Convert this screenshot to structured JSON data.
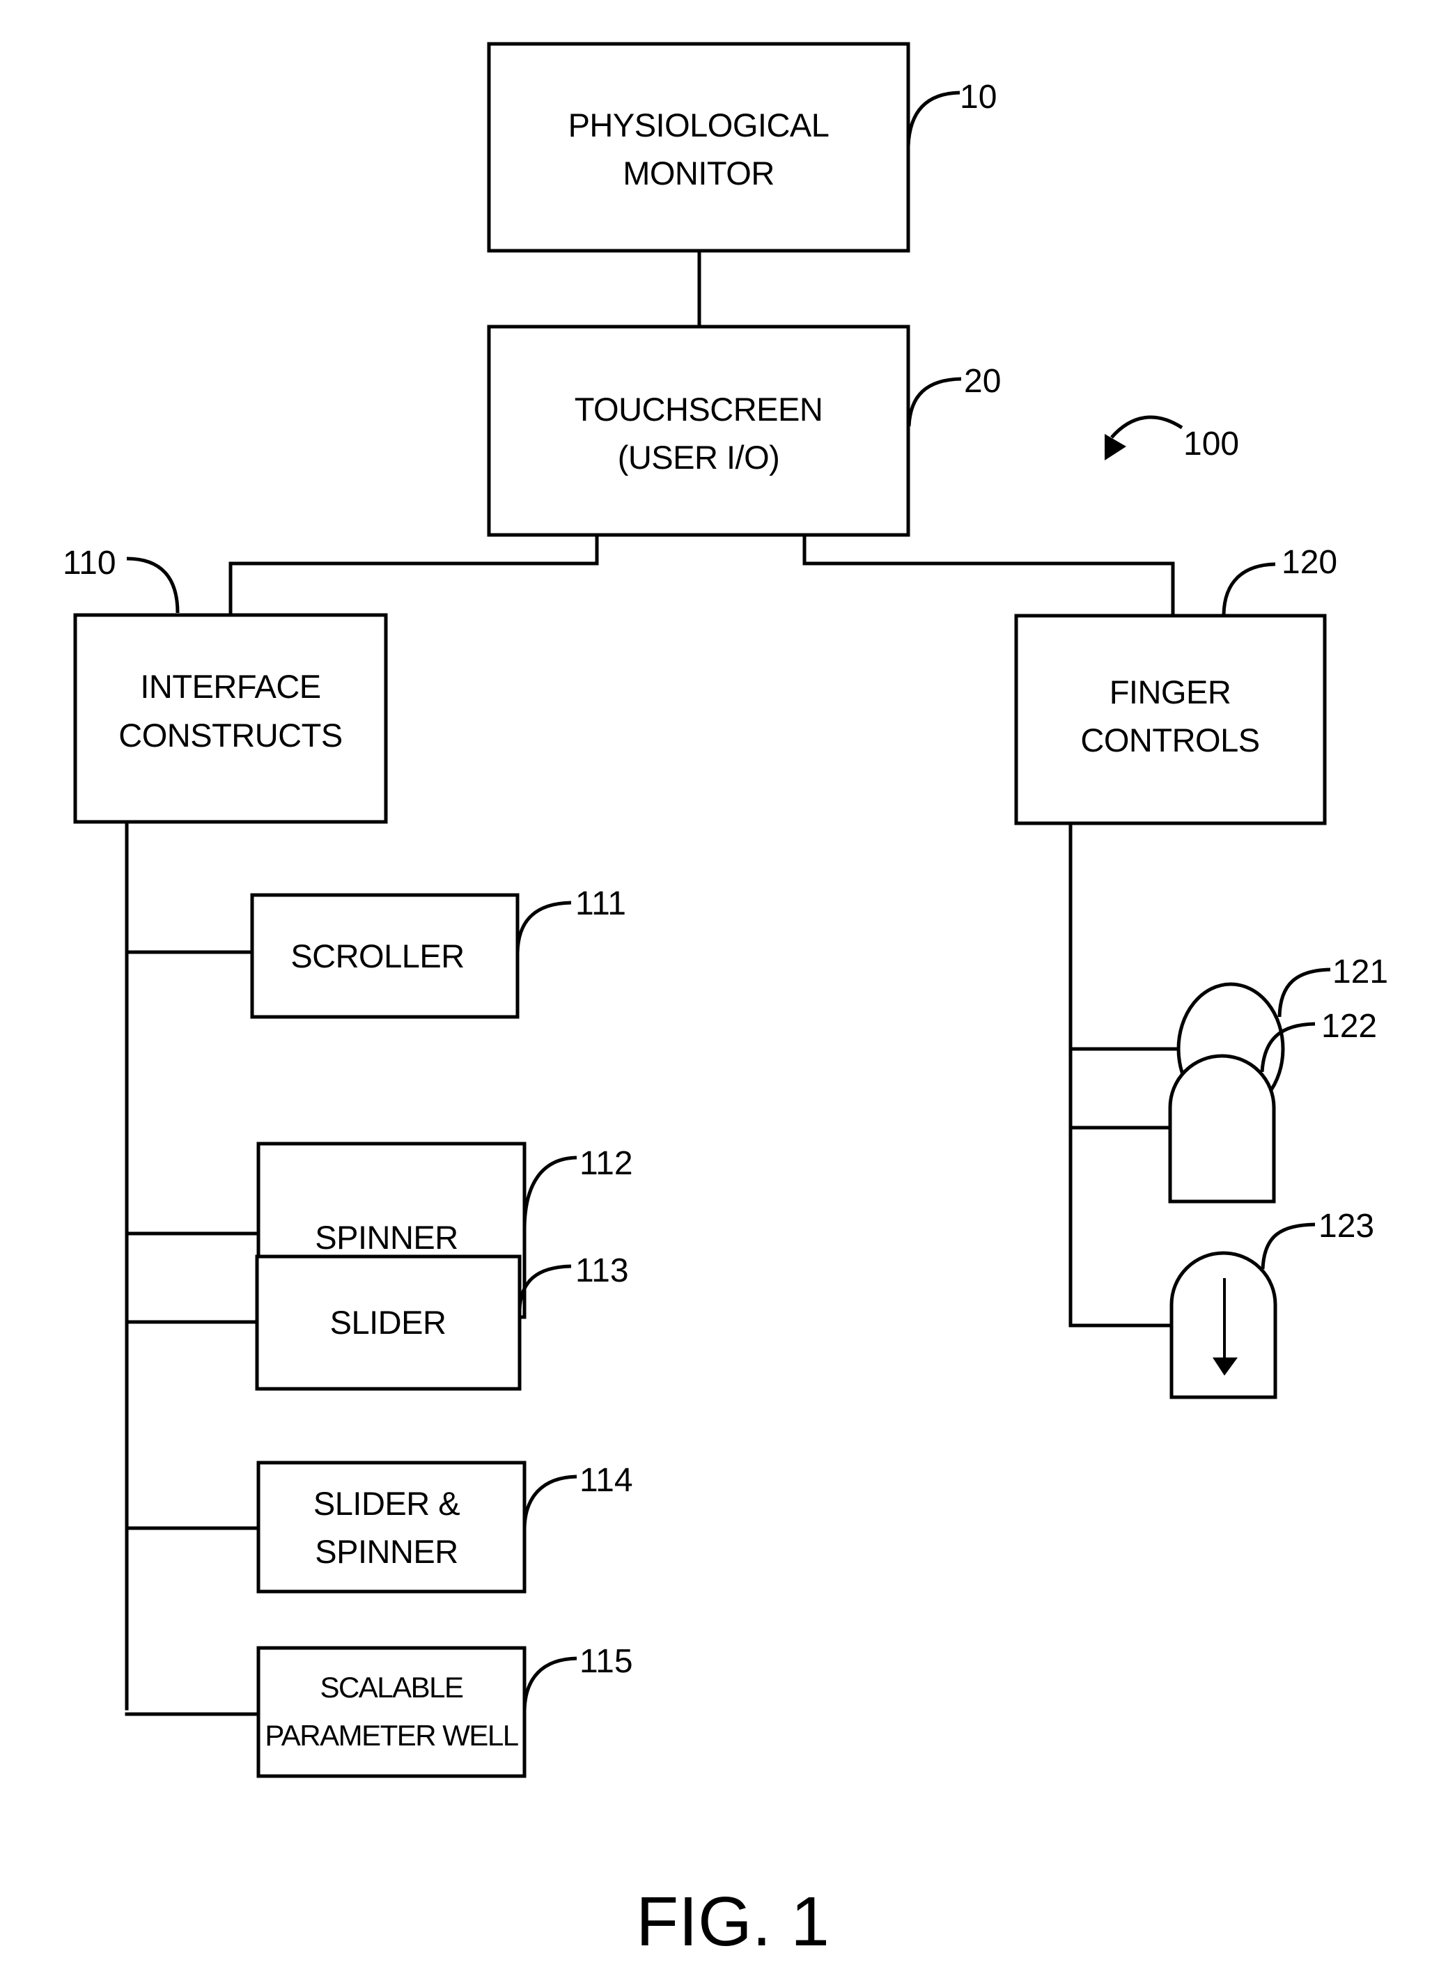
{
  "figure": {
    "caption": "FIG. 1",
    "system_ref": "100"
  },
  "nodes": {
    "monitor": {
      "ref": "10",
      "lines": [
        "PHYSIOLOGICAL",
        "MONITOR"
      ]
    },
    "touchscreen": {
      "ref": "20",
      "lines": [
        "TOUCHSCREEN",
        "(USER I/O)"
      ]
    },
    "interface_constructs": {
      "ref": "110",
      "lines": [
        "INTERFACE",
        "CONSTRUCTS"
      ]
    },
    "finger_controls": {
      "ref": "120",
      "lines": [
        "FINGER",
        "CONTROLS"
      ]
    },
    "constructs": [
      {
        "ref": "111",
        "lines": [
          "SCROLLER"
        ]
      },
      {
        "ref": "112",
        "lines": [
          "SPINNER"
        ]
      },
      {
        "ref": "113",
        "lines": [
          "SLIDER"
        ]
      },
      {
        "ref": "114",
        "lines": [
          "SLIDER &",
          "SPINNER"
        ]
      },
      {
        "ref": "115",
        "lines": [
          "SCALABLE",
          "PARAMETER WELL"
        ]
      }
    ],
    "controls": [
      {
        "ref": "121",
        "shape": "circle"
      },
      {
        "ref": "122",
        "shape": "rounded-top-tab"
      },
      {
        "ref": "123",
        "shape": "rounded-top-tab-with-down-arrow"
      }
    ]
  },
  "colors": {
    "ink": "#000000",
    "background": "#ffffff"
  }
}
